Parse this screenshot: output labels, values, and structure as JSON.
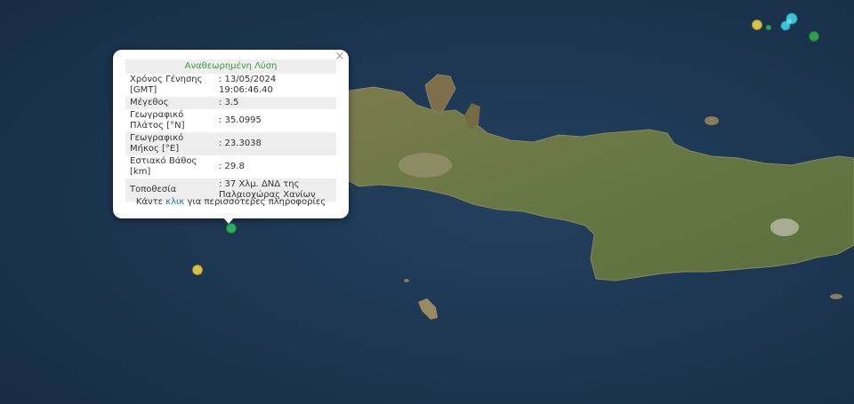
{
  "popup": {
    "title": "Αναθεωρημένη Λύση",
    "close_label": "×",
    "rows": [
      {
        "label": "Χρόνος Γένησης [GMT]",
        "value": ": 13/05/2024 19:06:46.40"
      },
      {
        "label": "Μέγεθος",
        "value": ": 3.5"
      },
      {
        "label": "Γεωγραφικό Πλάτος [°N]",
        "value": ": 35.0995"
      },
      {
        "label": "Γεωγραφικό Μήκος [°E]",
        "value": ": 23.3038"
      },
      {
        "label": "Εστιακό Βάθος [km]",
        "value": ": 29.8"
      },
      {
        "label": "Τοποθεσία",
        "value": ": 37 Χλμ. ΔΝΔ της Παλαιοχώρας Χανίων"
      }
    ],
    "footer_prefix": "Κάντε ",
    "footer_link": "κλικ",
    "footer_suffix": " για περισσότερες πληροφορίες"
  },
  "colors": {
    "sea": "#1c3550",
    "land": "#6f7a48",
    "selected_marker": "#2bb05f",
    "yellow_marker": "#d8c24a",
    "cyan_marker": "#3cc4dc",
    "green_marker": "#2f9e4f",
    "title_green": "#3c9a3c",
    "link_blue": "#1a73b8"
  }
}
